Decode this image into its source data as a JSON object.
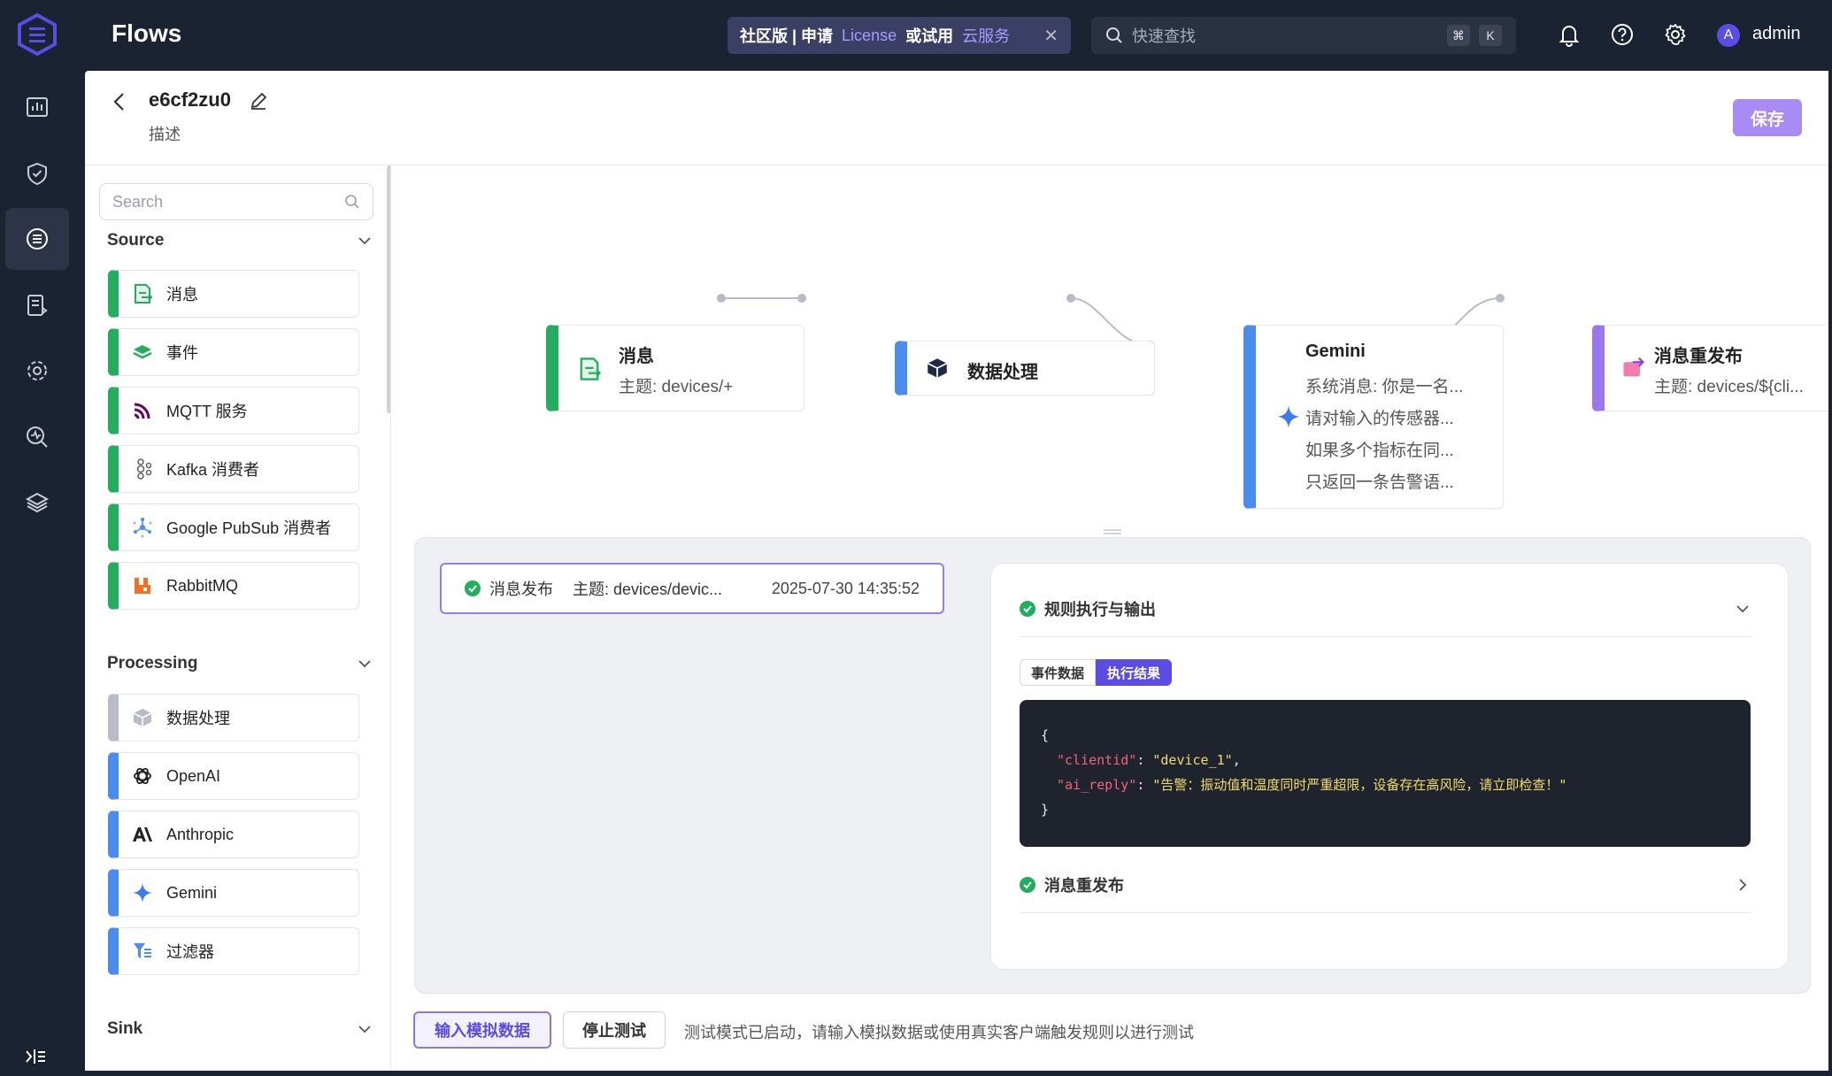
{
  "topbar": {
    "app_title": "Flows",
    "banner": {
      "prefix": "社区版 | 申请",
      "license": "License",
      "middle": "或试用",
      "cloud": "云服务",
      "close": "✕"
    },
    "search_placeholder": "快速查找",
    "shortcut_keys": [
      "⌘",
      "K"
    ],
    "avatar_letter": "A",
    "username": "admin"
  },
  "header": {
    "flow_name": "e6cf2zu0",
    "description": "描述",
    "save_label": "保存"
  },
  "palette": {
    "search_placeholder": "Search",
    "source": {
      "title": "Source",
      "items": [
        "消息",
        "事件",
        "MQTT 服务",
        "Kafka 消费者",
        "Google PubSub 消费者",
        "RabbitMQ"
      ]
    },
    "processing": {
      "title": "Processing",
      "items": [
        "数据处理",
        "OpenAI",
        "Anthropic",
        "Gemini",
        "过滤器"
      ]
    },
    "sink": {
      "title": "Sink"
    }
  },
  "canvas": {
    "nodes": [
      {
        "title": "消息",
        "lines": [
          "主题: devices/+"
        ]
      },
      {
        "title": "数据处理",
        "lines": []
      },
      {
        "title": "Gemini",
        "lines": [
          "系统消息: 你是一名...",
          "请对输入的传感器...",
          "如果多个指标在同...",
          "只返回一条告警语..."
        ]
      },
      {
        "title": "消息重发布",
        "lines": [
          "主题: devices/${cli..."
        ]
      }
    ]
  },
  "debug": {
    "event": {
      "type": "消息发布",
      "topic": "主题: devices/devic...",
      "timestamp": "2025-07-30 14:35:52"
    },
    "rule_section_title": "规则执行与输出",
    "tabs": [
      "事件数据",
      "执行结果"
    ],
    "active_tab": "执行结果",
    "code": {
      "open": "{",
      "k1": "\"clientid\"",
      "v1": "\"device_1\"",
      "k2": "\"ai_reply\"",
      "v2": "\"告警：振动值和温度同时严重超限，设备存在高风险，请立即检查！\"",
      "close": "}"
    },
    "republish_section_title": "消息重发布"
  },
  "footer": {
    "mock_button": "输入模拟数据",
    "stop_button": "停止测试",
    "hint": "测试模式已启动，请输入模拟数据或使用真实客户端触发规则以进行测试"
  },
  "colors": {
    "accent": "#5b4ce6",
    "source_green": "#22ae5e",
    "processing_blue": "#4b8cf1",
    "sink_purple": "#9a77f2",
    "topbar": "#1b2232"
  }
}
